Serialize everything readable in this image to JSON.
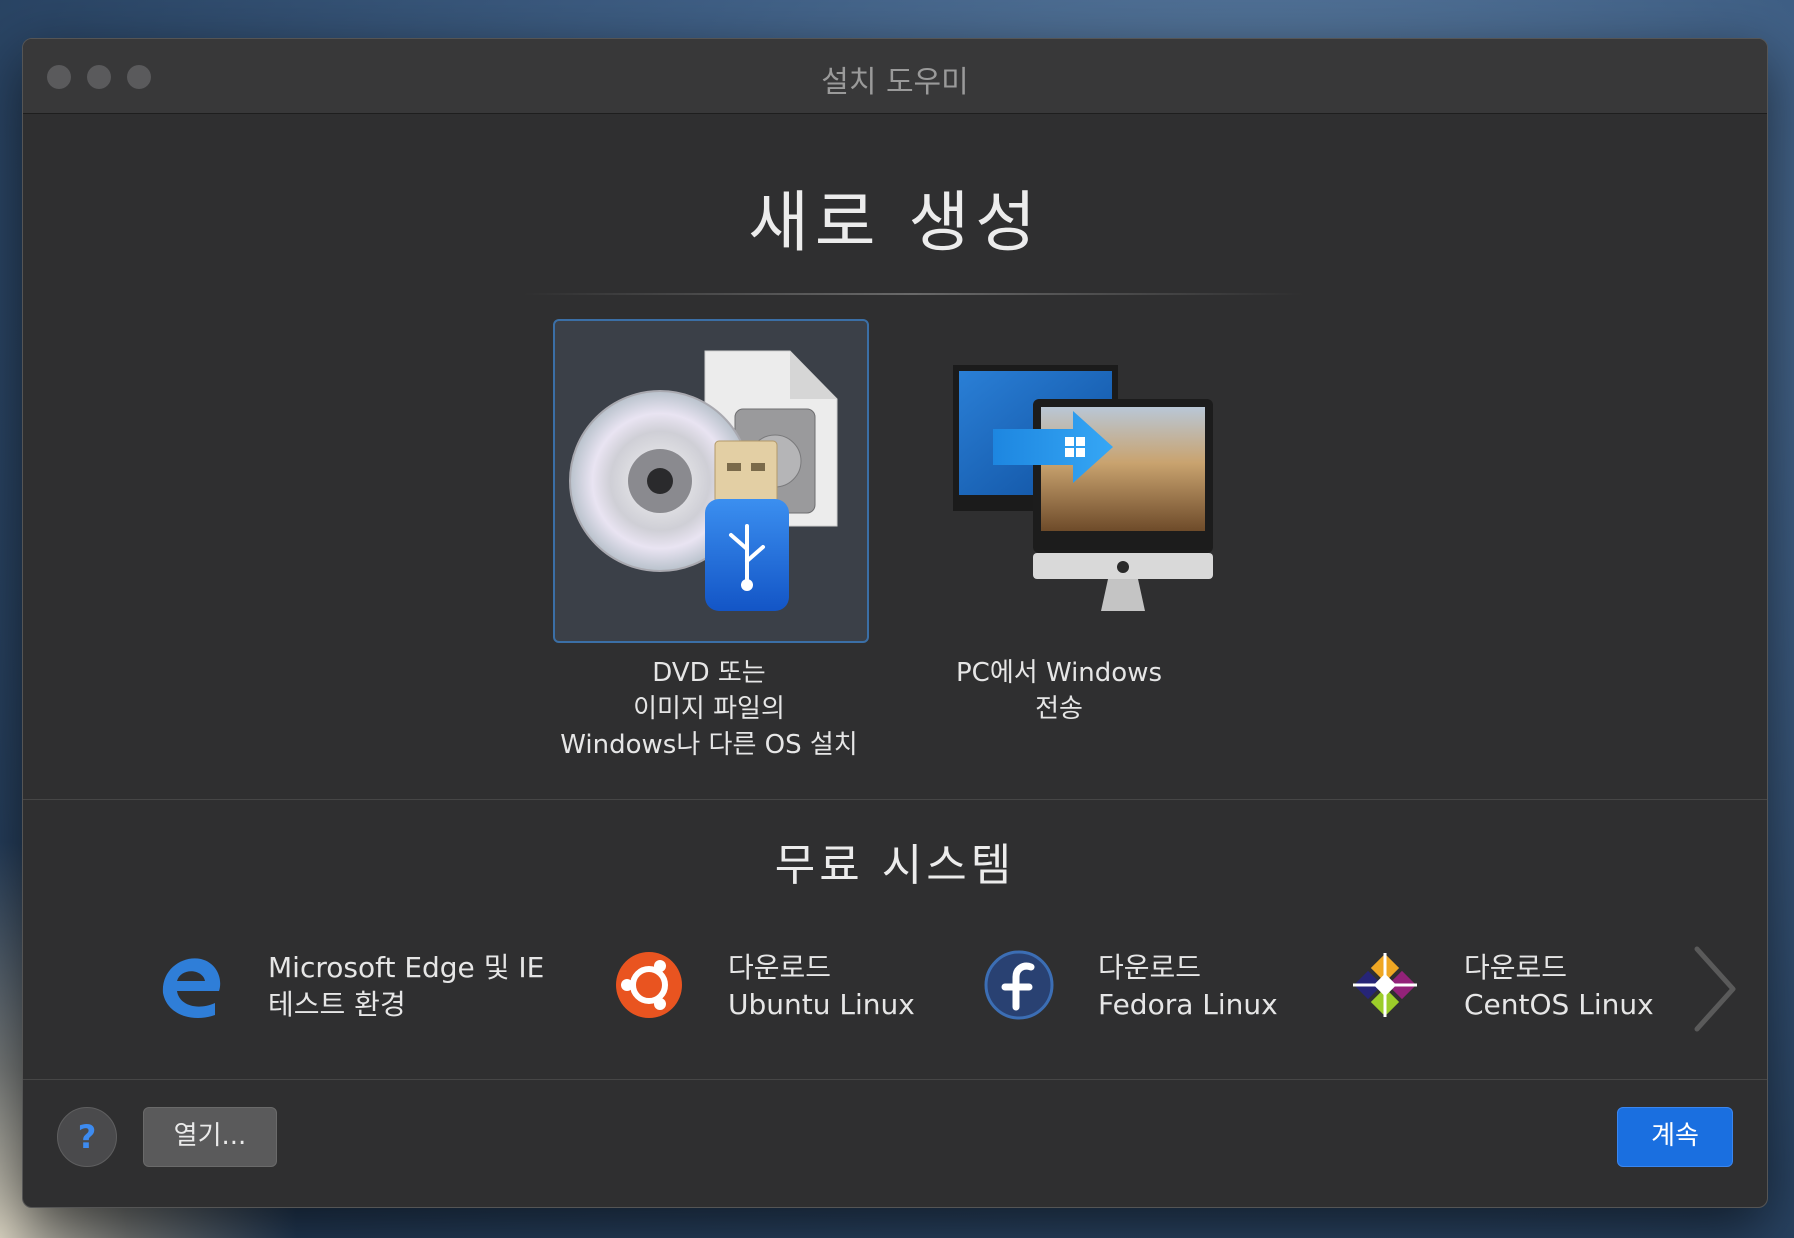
{
  "window": {
    "title": "설치 도우미",
    "traffic_lights": [
      "close",
      "minimize",
      "zoom"
    ]
  },
  "header": {
    "title": "새로 생성"
  },
  "options": [
    {
      "caption_lines": [
        "DVD 또는",
        "이미지 파일의",
        "Windows나 다른 OS 설치"
      ],
      "icon": "dvd-usb-image-icon",
      "selected": true
    },
    {
      "caption_lines": [
        "PC에서 Windows",
        "전송"
      ],
      "icon": "pc-to-mac-transfer-icon",
      "selected": false
    }
  ],
  "free_systems": {
    "title": "무료 시스템",
    "items": [
      {
        "line1": "Microsoft Edge 및 IE",
        "line2": "테스트 환경",
        "icon": "microsoft-edge-icon"
      },
      {
        "line1": "다운로드",
        "line2": "Ubuntu Linux",
        "icon": "ubuntu-icon"
      },
      {
        "line1": "다운로드",
        "line2": "Fedora Linux",
        "icon": "fedora-icon"
      },
      {
        "line1": "다운로드",
        "line2": "CentOS Linux",
        "icon": "centos-icon"
      }
    ]
  },
  "footer": {
    "help_label": "?",
    "open_label": "열기...",
    "continue_label": "계속"
  },
  "colors": {
    "window_bg": "#2f2f30",
    "accent_blue": "#1a6fe0",
    "selection_border": "#3b6fa6"
  }
}
